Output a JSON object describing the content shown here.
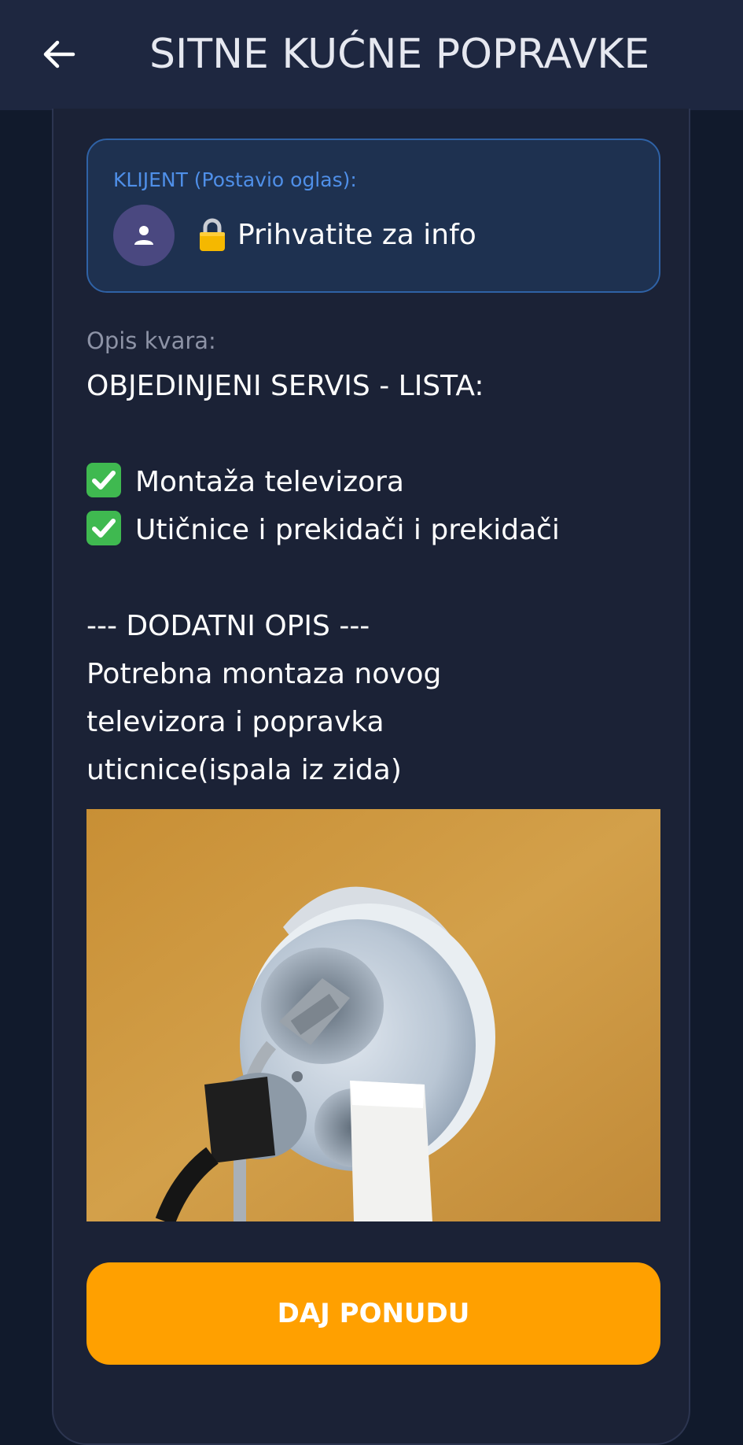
{
  "header": {
    "title": "SITNE KUĆNE POPRAVKE",
    "back_icon": "arrow-left-icon"
  },
  "client": {
    "label": "KLIJENT (Postavio oglas):",
    "avatar_icon": "person-icon",
    "lock_icon": "lock-icon",
    "info_text": "Prihvatite za info"
  },
  "description": {
    "label": "Opis kvara:",
    "heading": "OBJEDINJENI SERVIS - LISTA:",
    "services": [
      "Montaža televizora",
      "Utičnice i prekidači i prekidači"
    ],
    "extra_heading": "--- DODATNI OPIS ---",
    "extra_lines": [
      "Potrebna montaza novog",
      "televizora i popravka",
      "uticnice(ispala iz zida)"
    ]
  },
  "photo": {
    "subject": "damaged-wall-socket-photo"
  },
  "actions": {
    "offer_label": "DAJ PONUDU"
  },
  "colors": {
    "app_bar": "#1e2740",
    "background": "#111a2c",
    "card": "#1b2236",
    "client_box": "#1e3150",
    "client_label": "#4f8fe8",
    "avatar": "#4a4880",
    "check": "#3fb950",
    "button": "#ffa000"
  }
}
